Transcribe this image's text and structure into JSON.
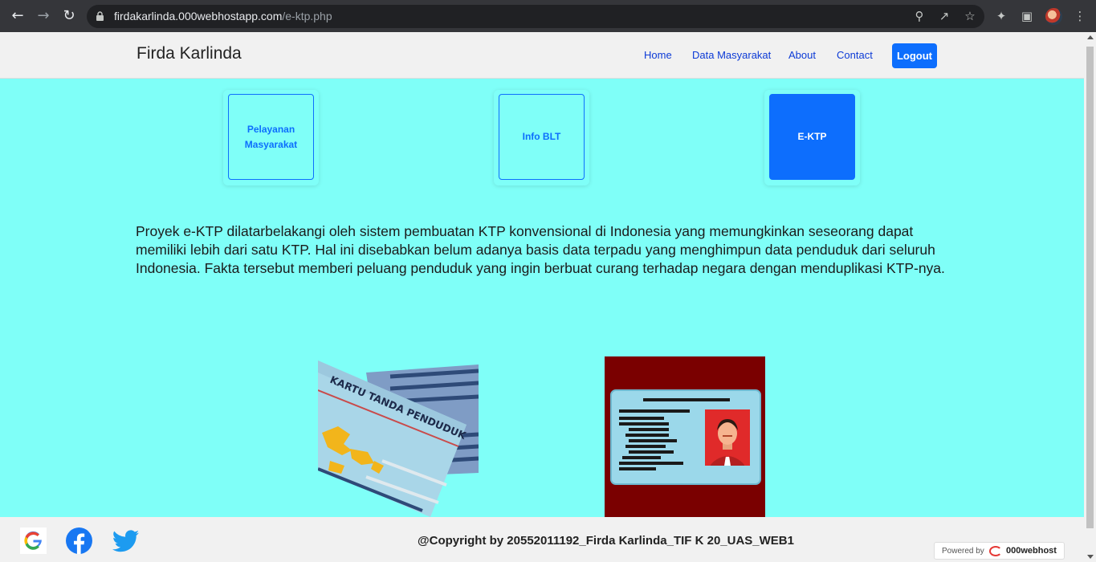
{
  "browser": {
    "url_host": "firdakarlinda.000webhostapp.com",
    "url_path": "/e-ktp.php"
  },
  "navbar": {
    "brand": "Firda Karlinda",
    "links": [
      "Home",
      "Data Masyarakat",
      "About",
      "Contact"
    ],
    "logout": "Logout"
  },
  "cards": [
    {
      "label": "Pelayanan Masyarakat",
      "active": false
    },
    {
      "label": "Info BLT",
      "active": false
    },
    {
      "label": "E-KTP",
      "active": true
    }
  ],
  "content": {
    "paragraph": "Proyek e-KTP dilatarbelakangi oleh sistem pembuatan KTP konvensional di Indonesia yang memungkinkan seseorang dapat memiliki lebih dari satu KTP. Hal ini disebabkan belum adanya basis data terpadu yang menghimpun data penduduk dari seluruh Indonesia. Fakta tersebut memberi peluang penduduk yang ingin berbuat curang terhadap negara dengan menduplikasi KTP-nya.",
    "ktp_card_text": "KARTU TANDA PENDUDUK"
  },
  "footer": {
    "copyright": "@Copyright by 20552011192_Firda Karlinda_TIF K 20_UAS_WEB1",
    "powered_label": "Powered by",
    "powered_brand": "000webhost",
    "social": [
      "google-icon",
      "facebook-icon",
      "twitter-icon"
    ]
  },
  "colors": {
    "page_bg": "#7ffff8",
    "primary": "#0d6efd",
    "id_image_bg": "#7a0000"
  }
}
